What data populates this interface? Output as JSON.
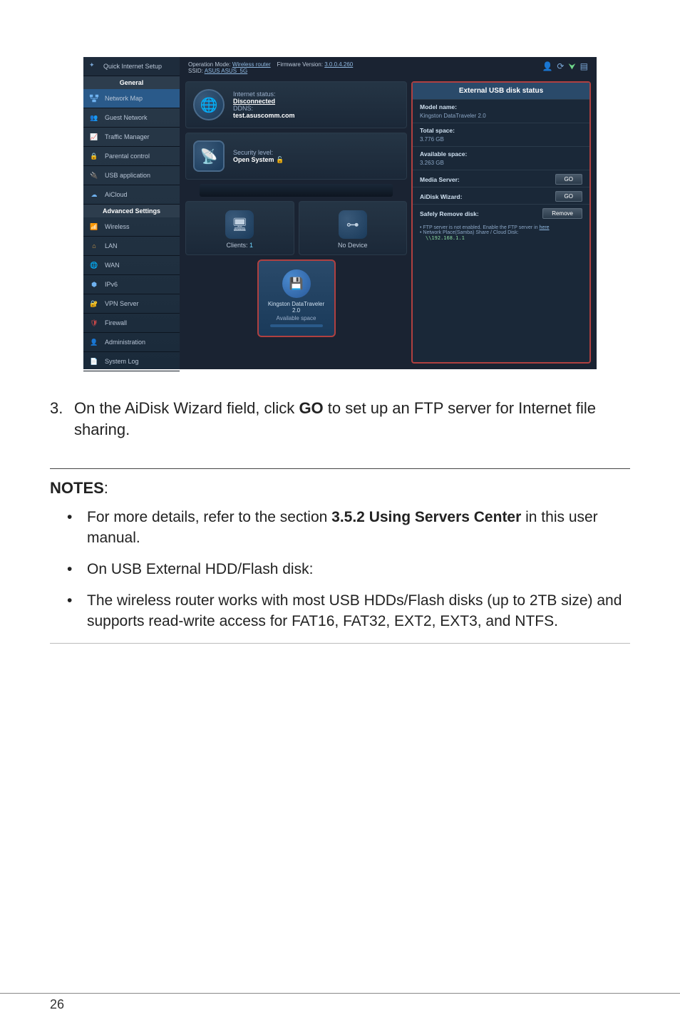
{
  "screenshot": {
    "topbar": {
      "opmode_label": "Operation Mode:",
      "opmode_value": "Wireless router",
      "fw_label": "Firmware Version:",
      "fw_value": "3.0.0.4.260",
      "ssid_label": "SSID:",
      "ssid_value": "ASUS  ASUS_5G"
    },
    "qis": {
      "title": "Quick Internet Setup"
    },
    "sections": {
      "general": "General",
      "advanced": "Advanced Settings"
    },
    "menu_general": [
      "Network Map",
      "Guest Network",
      "Traffic Manager",
      "Parental control",
      "USB application",
      "AiCloud"
    ],
    "menu_advanced": [
      "Wireless",
      "LAN",
      "WAN",
      "IPv6",
      "VPN Server",
      "Firewall",
      "Administration",
      "System Log"
    ],
    "tiles": {
      "internet": {
        "status_label": "Internet status:",
        "status_value": "Disconnected",
        "ddns_label": "DDNS:",
        "ddns_value": "test.asuscomm.com"
      },
      "security": {
        "label": "Security level:",
        "value": "Open System"
      },
      "clients": {
        "label": "Clients:",
        "value": "1"
      },
      "usbslot": {
        "value": "No Device"
      },
      "usbdev": {
        "name": "Kingston DataTraveler 2.0",
        "avail": "Available space"
      }
    },
    "panel": {
      "header": "External USB disk status",
      "model_label": "Model name:",
      "model_value": "Kingston DataTraveler 2.0",
      "total_label": "Total space:",
      "total_value": "3.776 GB",
      "avail_label": "Available space:",
      "avail_value": "3.263 GB",
      "media_label": "Media Server:",
      "aidisk_label": "AiDisk Wizard:",
      "remove_label": "Safely Remove disk:",
      "go_btn": "GO",
      "remove_btn": "Remove",
      "note_ftp_a": "FTP server is not enabled. Enable the FTP server in ",
      "note_ftp_b": "here",
      "note_samba": "Network Place(Samba) Share / Cloud Disk:",
      "ip": "\\\\192.168.1.1"
    }
  },
  "doc": {
    "step_num": "3.",
    "step_text_a": "On the AiDisk Wizard field, click ",
    "step_text_b": "GO",
    "step_text_c": " to set up an FTP server for Internet file sharing.",
    "notes_heading": "NOTES",
    "notes_colon": ":",
    "note1_a": "For more details, refer to the section ",
    "note1_b": "3.5.2 Using Servers Center",
    "note1_c": " in this user manual.",
    "note2": "On USB External HDD/Flash disk:",
    "note3": "The wireless router works with most USB HDDs/Flash disks (up to 2TB size) and supports read-write access for FAT16, FAT32, EXT2, EXT3, and NTFS.",
    "page_number": "26"
  }
}
